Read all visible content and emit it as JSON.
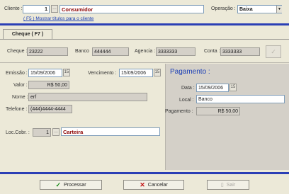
{
  "header": {
    "cliente_label": "Cliente :",
    "cliente_code": "1",
    "cliente_name": "Consumidor",
    "operacao_label": "Operação :",
    "operacao_value": "Baixa",
    "show_titles_link": "( F5 ) Mostrar títulos para o cliente"
  },
  "tab": {
    "label": "Cheque  ( F7 )"
  },
  "cheque": {
    "cheque_label": "Cheque :",
    "cheque_value": "23222",
    "banco_label": "Banco",
    "banco_value": "444444",
    "agencia_label": "Agencia :",
    "agencia_value": "3333333",
    "conta_label": "Conta :",
    "conta_value": "3333333"
  },
  "details": {
    "emissao_label": "Emissão :",
    "emissao_value": "15/09/2006",
    "vencimento_label": "Vencimento :",
    "vencimento_value": "15/09/2006",
    "valor_label": "Valor :",
    "valor_value": "R$ 50,00",
    "nome_label": "Nome :",
    "nome_value": "erf",
    "telefone_label": "Telefone :",
    "telefone_value": "(444)4444-4444",
    "loccobr_label": "Loc.Cobr. :",
    "loccobr_code": "1",
    "loccobr_name": "Carteira",
    "calendar_glyph": "15"
  },
  "pagamento": {
    "title": "Pagamento :",
    "data_label": "Data :",
    "data_value": "15/09/2006",
    "local_label": "Local :",
    "local_value": "Banco",
    "pagamento_label": "Pagamento :",
    "pagamento_value": "R$ 50,00"
  },
  "footer": {
    "processar_label": "Processar",
    "cancelar_label": "Cancelar",
    "sair_label": "Sair"
  },
  "colors": {
    "accent_blue": "#2b3fb5",
    "title_red": "#8b0000",
    "panel_gray": "#d4d0c8"
  }
}
